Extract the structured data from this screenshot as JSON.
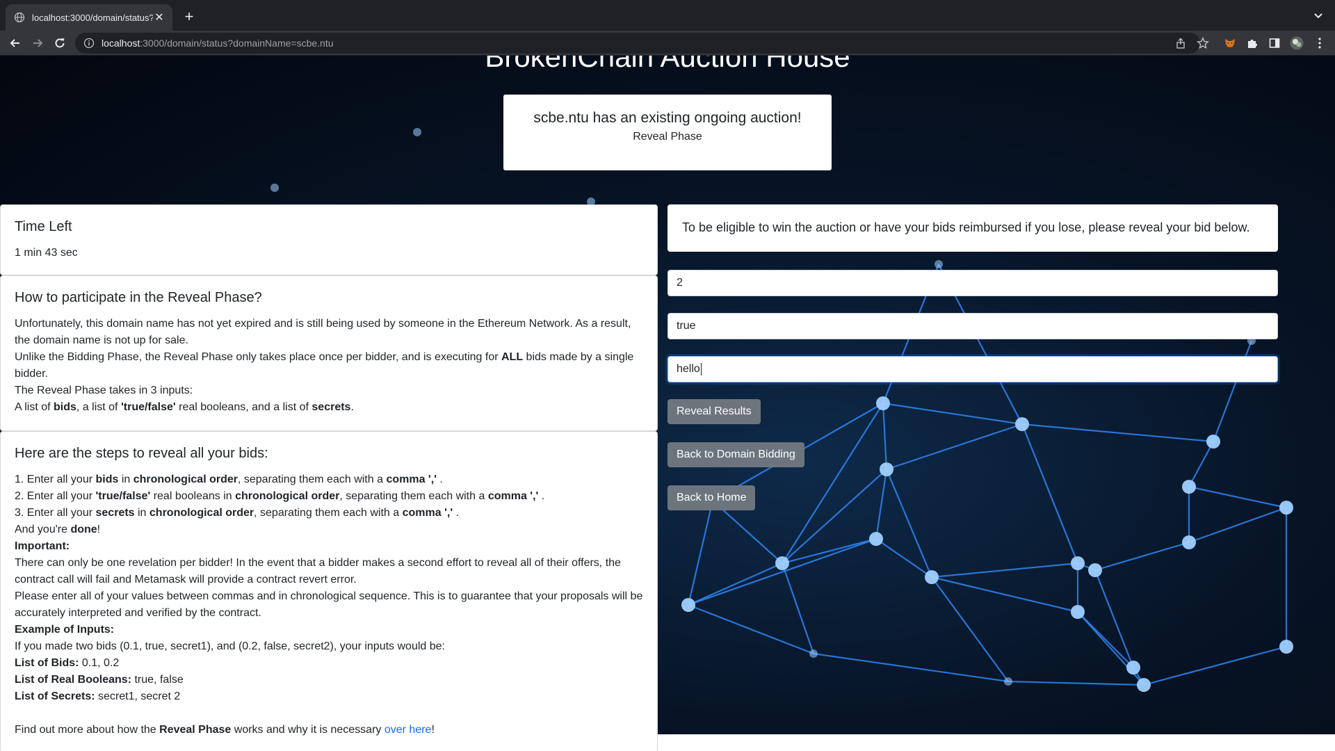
{
  "browser": {
    "tab_title": "localhost:3000/domain/status?",
    "url_host": "localhost",
    "url_rest": ":3000/domain/status?domainName=scbe.ntu"
  },
  "page": {
    "title": "BrokenChain Auction House",
    "status_title": "scbe.ntu has an existing ongoing auction!",
    "status_phase": "Reveal Phase"
  },
  "time_card": {
    "heading": "Time Left",
    "value": "1 min 43 sec"
  },
  "how_card": {
    "heading": "How to participate in the Reveal Phase?",
    "p1": "Unfortunately, this domain name has not yet expired and is still being used by someone in the Ethereum Network. As a result, the domain name is not up for sale.",
    "p2_a": "Unlike the Bidding Phase, the Reveal Phase only takes place once per bidder, and is executing for ",
    "p2_b": "ALL",
    "p2_c": " bids made by a single bidder.",
    "p3": "The Reveal Phase takes in 3 inputs:",
    "p4_a": "A list of ",
    "p4_b": "bids",
    "p4_c": ", a list of ",
    "p4_d": "'true/false'",
    "p4_e": " real booleans, and a list of ",
    "p4_f": "secrets",
    "p4_g": "."
  },
  "steps_card": {
    "heading": "Here are the steps to reveal all your bids:",
    "s1_a": "1. Enter all your ",
    "s1_b": "bids",
    "s1_c": " in ",
    "s1_d": "chronological order",
    "s1_e": ", separating them each with a ",
    "s1_f": "comma ','",
    "s1_g": " .",
    "s2_a": "2. Enter all your ",
    "s2_b": "'true/false'",
    "s2_c": " real booleans in ",
    "s2_d": "chronological order",
    "s2_e": ", separating them each with a ",
    "s2_f": "comma ','",
    "s2_g": " .",
    "s3_a": "3. Enter all your ",
    "s3_b": "secrets",
    "s3_c": " in ",
    "s3_d": "chronological order",
    "s3_e": ", separating them each with a ",
    "s3_f": "comma ','",
    "s3_g": " .",
    "done_a": "And you're ",
    "done_b": "done",
    "done_c": "!",
    "important_label": "Important:",
    "important_1": "There can only be one revelation per bidder! In the event that a bidder makes a second effort to reveal all of their offers, the contract call will fail and Metamask will provide a contract revert error.",
    "important_2": "Please enter all of your values between commas and in chronological sequence. This is to guarantee that your proposals will be accurately interpreted and verified by the contract.",
    "example_label": "Example of Inputs:",
    "example_text": "If you made two bids (0.1, true, secret1), and (0.2, false, secret2), your inputs would be:",
    "bids_label": "List of Bids:",
    "bids_value": " 0.1, 0.2",
    "booleans_label": "List of Real Booleans:",
    "booleans_value": " true, false",
    "secrets_label": "List of Secrets:",
    "secrets_value": " secret1, secret 2",
    "more_a": "Find out more about how the ",
    "more_b": "Reveal Phase",
    "more_c": " works and why it is necessary ",
    "more_link": "over here",
    "more_d": "!"
  },
  "reveal_form": {
    "note": "To be eligible to win the auction or have your bids reimbursed if you lose, please reveal your bid below.",
    "bids_value": "2",
    "booleans_value": "true",
    "secrets_value": "hello",
    "reveal_button": "Reveal Results",
    "back_bidding_button": "Back to Domain Bidding",
    "back_home_button": "Back to Home"
  },
  "icons": [
    "globe-icon",
    "close-icon",
    "plus-icon",
    "back-arrow-icon",
    "forward-arrow-icon",
    "reload-icon",
    "info-icon",
    "share-icon",
    "star-icon",
    "metamask-fox-icon",
    "extensions-puzzle-icon",
    "side-panel-icon",
    "profile-avatar-icon",
    "kebab-menu-icon",
    "chevron-down-icon"
  ],
  "colors": {
    "button_gray": "#6c757d",
    "link_blue": "#0d6efd",
    "background_dark": "#071426",
    "network_blue": "#1e90ff"
  }
}
